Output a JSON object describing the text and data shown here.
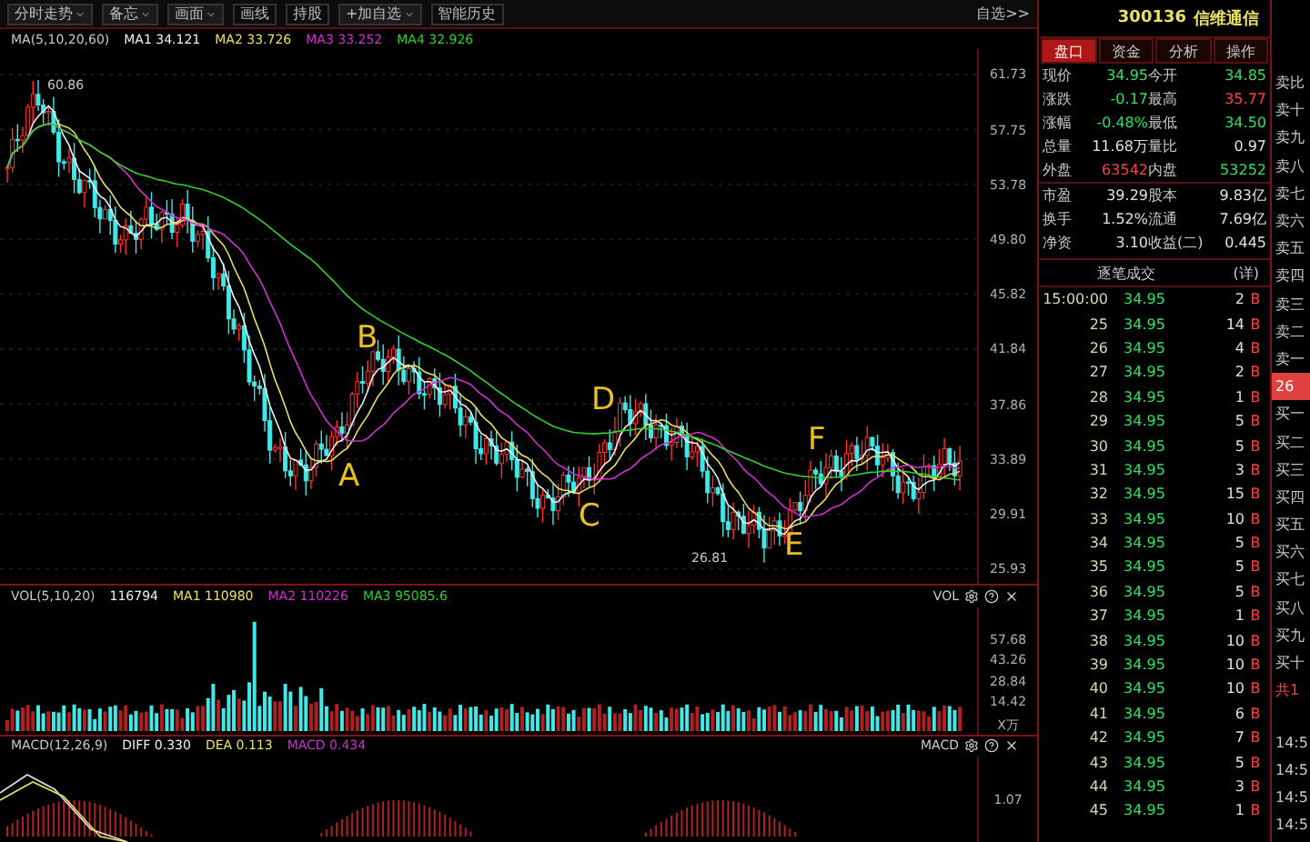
{
  "toolbar": {
    "items": [
      {
        "label": "分时走势",
        "kind": "menu"
      },
      {
        "label": "备忘",
        "kind": "menu"
      },
      {
        "label": "画面",
        "kind": "menu"
      },
      {
        "label": "画线",
        "kind": "button"
      },
      {
        "label": "持股",
        "kind": "button"
      },
      {
        "label": "+加自选",
        "kind": "menu"
      },
      {
        "label": "智能历史",
        "kind": "button"
      }
    ],
    "link": "自选>>"
  },
  "price_chart": {
    "legend": [
      {
        "label": "MA(5,10,20,60)",
        "color": "#c8c8c8"
      },
      {
        "label": "MA1 34.121",
        "color": "#f0f0f0"
      },
      {
        "label": "MA2 33.726",
        "color": "#e8e060"
      },
      {
        "label": "MA3 33.252",
        "color": "#d030d0"
      },
      {
        "label": "MA4 32.926",
        "color": "#30d030"
      }
    ],
    "y_axis": [
      "61.73",
      "57.75",
      "53.78",
      "49.80",
      "45.82",
      "41.84",
      "37.86",
      "33.89",
      "29.91",
      "25.93"
    ],
    "high_label": "60.86",
    "low_label": "26.81",
    "wave_labels": [
      "A",
      "B",
      "C",
      "D",
      "E",
      "F"
    ]
  },
  "volume_chart": {
    "legend": [
      {
        "label": "VOL(5,10,20)",
        "color": "#c8c8c8"
      },
      {
        "label": "116794",
        "color": "#f0f0f0"
      },
      {
        "label": "MA1 110980",
        "color": "#e8e060"
      },
      {
        "label": "MA2 110226",
        "color": "#d030d0"
      },
      {
        "label": "MA3 95085.6",
        "color": "#30d030"
      }
    ],
    "name": "VOL",
    "y_axis": [
      "57.68",
      "43.26",
      "28.84",
      "14.42"
    ],
    "unit": "X万"
  },
  "macd_chart": {
    "legend": [
      {
        "label": "MACD(12,26,9)",
        "color": "#c8c8c8"
      },
      {
        "label": "DIFF 0.330",
        "color": "#f0f0f0"
      },
      {
        "label": "DEA 0.113",
        "color": "#e8e060"
      },
      {
        "label": "MACD 0.434",
        "color": "#d030d0"
      }
    ],
    "name": "MACD",
    "y_axis": [
      "1.07"
    ]
  },
  "stock": {
    "code": "300136",
    "name": "信维通信"
  },
  "tabs": [
    {
      "label": "盘口",
      "selected": true
    },
    {
      "label": "资金",
      "selected": false
    },
    {
      "label": "分析",
      "selected": false
    },
    {
      "label": "操作",
      "selected": false
    }
  ],
  "quotes": [
    {
      "cells": [
        {
          "label": "现价",
          "value": "34.95",
          "color": "#30e060"
        },
        {
          "label": "今开",
          "value": "34.85",
          "color": "#30e060"
        }
      ]
    },
    {
      "cells": [
        {
          "label": "涨跌",
          "value": "-0.17",
          "color": "#30e060"
        },
        {
          "label": "最高",
          "value": "35.77",
          "color": "#ff4040"
        }
      ]
    },
    {
      "cells": [
        {
          "label": "涨幅",
          "value": "-0.48%",
          "color": "#30e060"
        },
        {
          "label": "最低",
          "value": "34.50",
          "color": "#30e060"
        }
      ]
    },
    {
      "cells": [
        {
          "label": "总量",
          "value": "11.68万",
          "color": "#e0e0e0"
        },
        {
          "label": "量比",
          "value": "0.97",
          "color": "#e0e0e0"
        }
      ]
    },
    {
      "cells": [
        {
          "label": "外盘",
          "value": "63542",
          "color": "#ff4040"
        },
        {
          "label": "内盘",
          "value": "53252",
          "color": "#30e060"
        }
      ]
    },
    {
      "cells": [
        {
          "label": "市盈",
          "value": "39.29",
          "color": "#e0e0e0"
        },
        {
          "label": "股本",
          "value": "9.83亿",
          "color": "#e0e0e0"
        }
      ]
    },
    {
      "cells": [
        {
          "label": "换手",
          "value": "1.52%",
          "color": "#e0e0e0"
        },
        {
          "label": "流通",
          "value": "7.69亿",
          "color": "#e0e0e0"
        }
      ]
    },
    {
      "cells": [
        {
          "label": "净资",
          "value": "3.10",
          "color": "#e0e0e0"
        },
        {
          "label": "收益(二)",
          "value": "0.445",
          "color": "#e0e0e0"
        }
      ]
    }
  ],
  "trades_header": {
    "title": "逐笔成交",
    "link": "(详)"
  },
  "trades": [
    {
      "time": "15:00:00",
      "price": "34.95",
      "volume": "2",
      "side": "B"
    },
    {
      "time": "25",
      "price": "34.95",
      "volume": "14",
      "side": "B"
    },
    {
      "time": "26",
      "price": "34.95",
      "volume": "4",
      "side": "B"
    },
    {
      "time": "27",
      "price": "34.95",
      "volume": "2",
      "side": "B"
    },
    {
      "time": "28",
      "price": "34.95",
      "volume": "1",
      "side": "B"
    },
    {
      "time": "29",
      "price": "34.95",
      "volume": "5",
      "side": "B"
    },
    {
      "time": "30",
      "price": "34.95",
      "volume": "5",
      "side": "B"
    },
    {
      "time": "31",
      "price": "34.95",
      "volume": "3",
      "side": "B"
    },
    {
      "time": "32",
      "price": "34.95",
      "volume": "15",
      "side": "B"
    },
    {
      "time": "33",
      "price": "34.95",
      "volume": "10",
      "side": "B"
    },
    {
      "time": "34",
      "price": "34.95",
      "volume": "5",
      "side": "B"
    },
    {
      "time": "35",
      "price": "34.95",
      "volume": "5",
      "side": "B"
    },
    {
      "time": "36",
      "price": "34.95",
      "volume": "5",
      "side": "B"
    },
    {
      "time": "37",
      "price": "34.95",
      "volume": "1",
      "side": "B"
    },
    {
      "time": "38",
      "price": "34.95",
      "volume": "10",
      "side": "B"
    },
    {
      "time": "39",
      "price": "34.95",
      "volume": "10",
      "side": "B"
    },
    {
      "time": "40",
      "price": "34.95",
      "volume": "10",
      "side": "B"
    },
    {
      "time": "41",
      "price": "34.95",
      "volume": "6",
      "side": "B"
    },
    {
      "time": "42",
      "price": "34.95",
      "volume": "7",
      "side": "B"
    },
    {
      "time": "43",
      "price": "34.95",
      "volume": "5",
      "side": "B"
    },
    {
      "time": "44",
      "price": "34.95",
      "volume": "3",
      "side": "B"
    },
    {
      "time": "45",
      "price": "34.95",
      "volume": "1",
      "side": "B"
    }
  ],
  "order_book": [
    {
      "label": "卖比",
      "kind": "label"
    },
    {
      "label": "卖十",
      "kind": "label"
    },
    {
      "label": "卖九",
      "kind": "label"
    },
    {
      "label": "卖八",
      "kind": "label"
    },
    {
      "label": "卖七",
      "kind": "label"
    },
    {
      "label": "卖六",
      "kind": "label"
    },
    {
      "label": "卖五",
      "kind": "label"
    },
    {
      "label": "卖四",
      "kind": "label"
    },
    {
      "label": "卖三",
      "kind": "label"
    },
    {
      "label": "卖二",
      "kind": "label"
    },
    {
      "label": "卖一",
      "kind": "label"
    },
    {
      "label": "26",
      "kind": "current"
    },
    {
      "label": "买一",
      "kind": "label"
    },
    {
      "label": "买二",
      "kind": "label"
    },
    {
      "label": "买三",
      "kind": "label"
    },
    {
      "label": "买四",
      "kind": "label"
    },
    {
      "label": "买五",
      "kind": "label"
    },
    {
      "label": "买六",
      "kind": "label"
    },
    {
      "label": "买七",
      "kind": "label"
    },
    {
      "label": "买八",
      "kind": "label"
    },
    {
      "label": "买九",
      "kind": "label"
    },
    {
      "label": "买十",
      "kind": "label"
    },
    {
      "label": "共1",
      "kind": "total"
    }
  ],
  "order_times": [
    "14:5",
    "14:5",
    "14:5",
    "14:5"
  ]
}
